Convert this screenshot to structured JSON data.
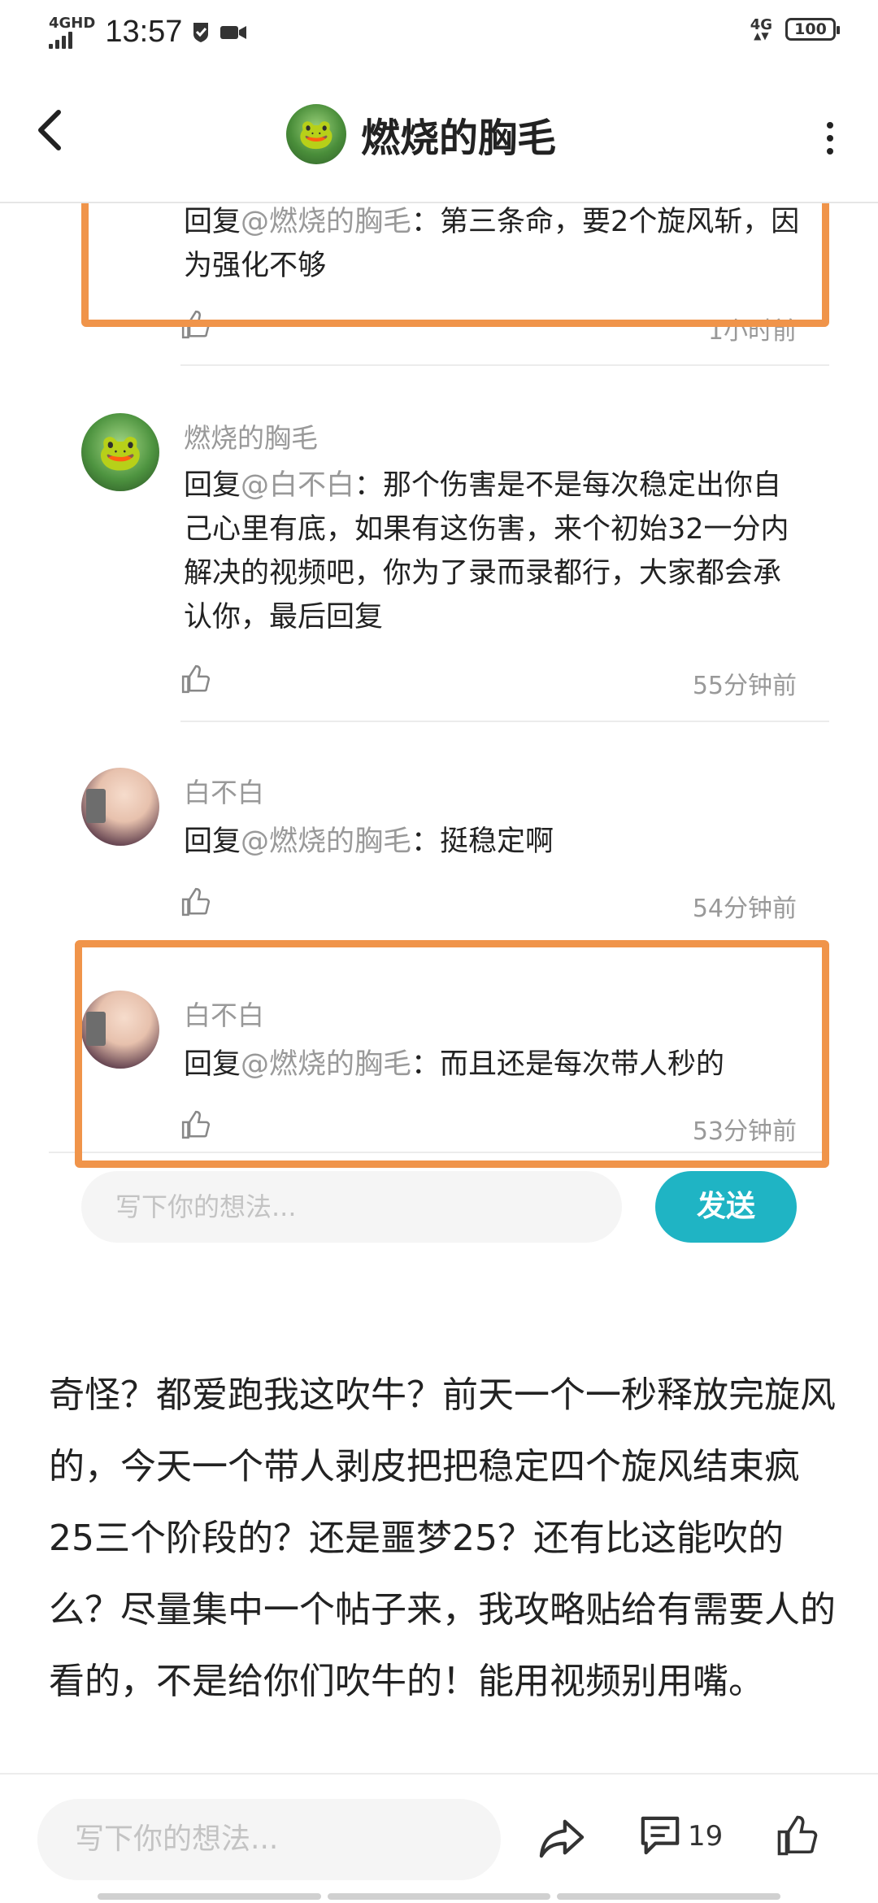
{
  "status_bar": {
    "network_left": "4GHD",
    "time": "13:57",
    "network_right": "4G",
    "battery": "100"
  },
  "header": {
    "title": "燃烧的胸毛"
  },
  "comments": [
    {
      "name": "",
      "reply_prefix": "回复",
      "mention": "@燃烧的胸毛",
      "text": "：第三条命，要2个旋风斩，因为强化不够",
      "time": "1小时前"
    },
    {
      "name": "燃烧的胸毛",
      "reply_prefix": "回复",
      "mention": "@白不白",
      "text": "：那个伤害是不是每次稳定出你自己心里有底，如果有这伤害，来个初始32一分内解决的视频吧，你为了录而录都行，大家都会承认你，最后回复",
      "time": "55分钟前"
    },
    {
      "name": "白不白",
      "reply_prefix": "回复",
      "mention": "@燃烧的胸毛",
      "text": "：挺稳定啊",
      "time": "54分钟前"
    },
    {
      "name": "白不白",
      "reply_prefix": "回复",
      "mention": "@燃烧的胸毛",
      "text": "：而且还是每次带人秒的",
      "time": "53分钟前"
    }
  ],
  "reply": {
    "placeholder": "写下你的想法...",
    "send_label": "发送"
  },
  "post": {
    "body": "奇怪？都爱跑我这吹牛？前天一个一秒释放完旋风的，今天一个带人剥皮把把稳定四个旋风结束疯25三个阶段的？还是噩梦25？还有比这能吹的么？尽量集中一个帖子来，我攻略贴给有需要人的看的，不是给你们吹牛的！能用视频别用嘴。"
  },
  "bottom_bar": {
    "placeholder": "写下你的想法...",
    "comment_count": "19"
  },
  "colors": {
    "highlight": "#f0944a",
    "send_button": "#1fb4c4",
    "muted_text": "#999999"
  },
  "icons": [
    "back-arrow-icon",
    "more-vert-icon",
    "thumbs-up-icon",
    "share-icon",
    "comment-icon"
  ]
}
